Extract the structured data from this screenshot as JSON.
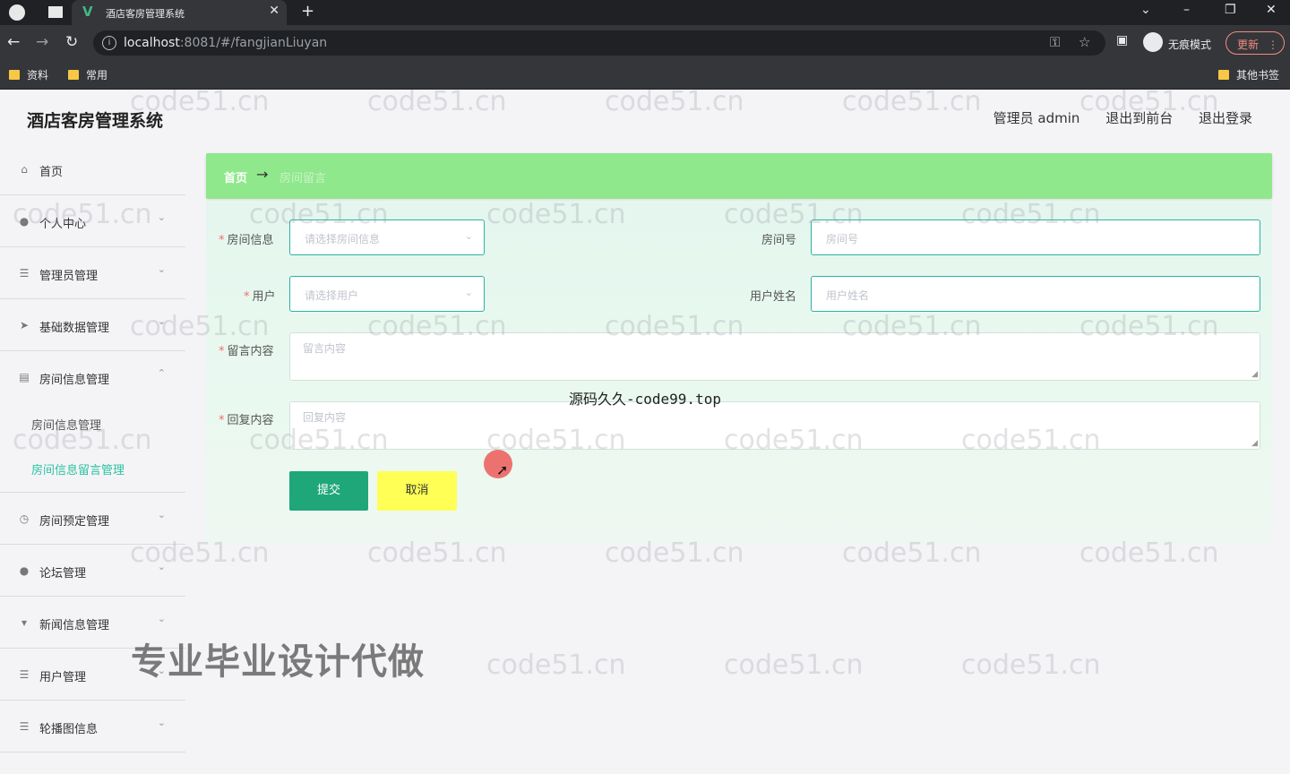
{
  "browser": {
    "tab_title": "酒店客房管理系统",
    "url_host": "localhost",
    "url_rest": ":8081/#/fangjianLiuyan",
    "incognito_label": "无痕模式",
    "update_label": "更新",
    "bookmarks": [
      "资料",
      "常用"
    ],
    "other_bookmarks": "其他书签"
  },
  "app": {
    "title": "酒店客房管理系统",
    "header_links": [
      "管理员 admin",
      "退出到前台",
      "退出登录"
    ]
  },
  "sidebar": {
    "items": [
      {
        "label": "首页",
        "icon": "home-icon"
      },
      {
        "label": "个人中心",
        "icon": "user-icon"
      },
      {
        "label": "管理员管理",
        "icon": "sliders-icon"
      },
      {
        "label": "基础数据管理",
        "icon": "send-icon"
      },
      {
        "label": "房间信息管理",
        "icon": "clipboard-icon"
      },
      {
        "label": "房间预定管理",
        "icon": "clock-icon"
      },
      {
        "label": "论坛管理",
        "icon": "user-icon"
      },
      {
        "label": "新闻信息管理",
        "icon": "sign-icon"
      },
      {
        "label": "用户管理",
        "icon": "list-icon"
      },
      {
        "label": "轮播图信息",
        "icon": "list-icon"
      }
    ],
    "subitems": [
      "房间信息管理",
      "房间信息留言管理"
    ]
  },
  "breadcrumb": {
    "home": "首页",
    "arrow": "→",
    "current": "房间留言"
  },
  "form": {
    "room_info_label": "房间信息",
    "room_info_placeholder": "请选择房间信息",
    "room_no_label": "房间号",
    "room_no_placeholder": "房间号",
    "user_label": "用户",
    "user_placeholder": "请选择用户",
    "user_name_label": "用户姓名",
    "user_name_placeholder": "用户姓名",
    "message_label": "留言内容",
    "message_placeholder": "留言内容",
    "reply_label": "回复内容",
    "reply_placeholder": "回复内容",
    "submit_label": "提交",
    "cancel_label": "取消"
  },
  "overlay": {
    "watermark": "code51.cn",
    "center_text": "源码久久-code99.top",
    "promo_text": "专业毕业设计代做"
  },
  "colors": {
    "breadcrumb_bg": "#8fe88b",
    "submit_bg": "#1fa77a",
    "cancel_bg": "#ffff55",
    "active_menu": "#2bc2a2",
    "input_border": "#2bb3a0"
  }
}
